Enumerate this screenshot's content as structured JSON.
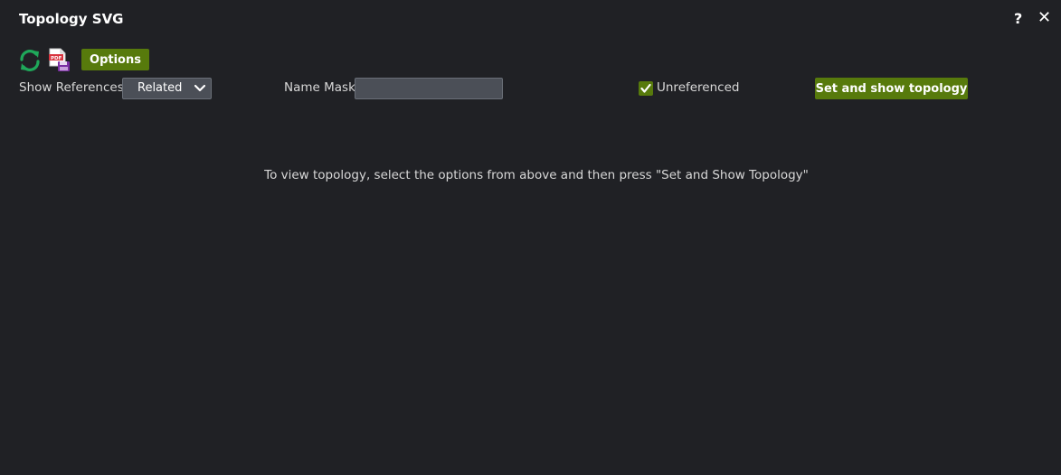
{
  "window": {
    "title": "Topology SVG",
    "help_label": "?",
    "close_label": "✕"
  },
  "toolbar": {
    "refresh_icon": "refresh-icon",
    "pdf_icon": "pdf-save-icon",
    "options_label": "Options"
  },
  "filters": {
    "show_references_label": "Show References:",
    "show_references_value": "Related",
    "name_mask_label": "Name Mask:",
    "name_mask_value": "",
    "unreferenced_label": "Unreferenced",
    "unreferenced_checked": true,
    "set_button_label": "Set and show topology"
  },
  "main": {
    "message": "To view topology, select the options from above and then press \"Set and Show Topology\""
  },
  "colors": {
    "background": "#202125",
    "accent": "#577a0c",
    "input_bg": "#4b4f57",
    "refresh_icon": "#1fa85a",
    "pdf_icon": "#d8343f"
  }
}
